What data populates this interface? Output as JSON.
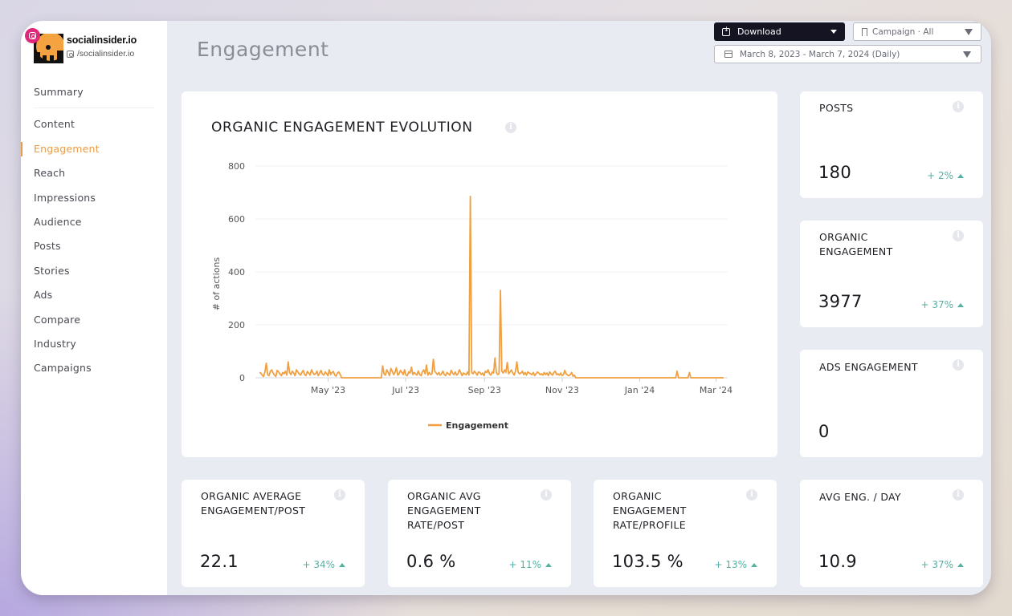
{
  "profile": {
    "name": "socialinsider.io",
    "handle": "/socialinsider.io",
    "network": "instagram"
  },
  "sidebar": {
    "items": [
      {
        "label": "Summary",
        "active": false
      },
      {
        "label": "Content",
        "active": false
      },
      {
        "label": "Engagement",
        "active": true
      },
      {
        "label": "Reach",
        "active": false
      },
      {
        "label": "Impressions",
        "active": false
      },
      {
        "label": "Audience",
        "active": false
      },
      {
        "label": "Posts",
        "active": false
      },
      {
        "label": "Stories",
        "active": false
      },
      {
        "label": "Ads",
        "active": false
      },
      {
        "label": "Compare",
        "active": false
      },
      {
        "label": "Industry",
        "active": false
      },
      {
        "label": "Campaigns",
        "active": false
      }
    ]
  },
  "header": {
    "title": "Engagement",
    "download_label": "Download",
    "campaign_label": "Campaign · All",
    "date_range_label": "March 8, 2023 - March 7, 2024 (Daily)"
  },
  "colors": {
    "accent": "#eb9b45",
    "series": "#f0a040",
    "positive": "#53b2a4",
    "dark_button": "#141423"
  },
  "chart_card": {
    "title": "ORGANIC ENGAGEMENT EVOLUTION",
    "info_icon": "info-icon"
  },
  "chart_data": {
    "type": "line",
    "title": "ORGANIC ENGAGEMENT EVOLUTION",
    "xlabel": "",
    "ylabel": "# of actions",
    "x_start": "2023-03-08",
    "x_end": "2024-03-07",
    "x_interval": "daily",
    "ylim": [
      0,
      800
    ],
    "y_ticks": [
      0,
      200,
      400,
      600,
      800
    ],
    "x_ticks": [
      {
        "label": "May '23",
        "date": "2023-05-01"
      },
      {
        "label": "Jul '23",
        "date": "2023-07-01"
      },
      {
        "label": "Sep '23",
        "date": "2023-09-01"
      },
      {
        "label": "Nov '23",
        "date": "2023-11-01"
      },
      {
        "label": "Jan '24",
        "date": "2024-01-01"
      },
      {
        "label": "Mar '24",
        "date": "2024-03-01"
      }
    ],
    "grid": true,
    "legend": {
      "position": "bottom",
      "entries": [
        "Engagement"
      ]
    },
    "series": [
      {
        "name": "Engagement",
        "values": [
          20,
          18,
          10,
          5,
          22,
          55,
          12,
          8,
          25,
          30,
          18,
          10,
          5,
          28,
          22,
          14,
          8,
          20,
          15,
          25,
          10,
          60,
          20,
          12,
          25,
          18,
          8,
          30,
          22,
          15,
          10,
          20,
          28,
          12,
          8,
          24,
          18,
          10,
          30,
          20,
          12,
          15,
          25,
          8,
          18,
          28,
          14,
          10,
          22,
          16,
          8,
          30,
          12,
          20,
          24,
          10,
          6,
          18,
          22,
          12,
          0,
          0,
          0,
          0,
          0,
          0,
          0,
          0,
          0,
          0,
          0,
          0,
          0,
          0,
          0,
          0,
          0,
          0,
          0,
          0,
          0,
          0,
          0,
          0,
          0,
          0,
          0,
          0,
          0,
          0,
          45,
          15,
          10,
          30,
          20,
          8,
          35,
          25,
          12,
          20,
          38,
          10,
          15,
          28,
          20,
          12,
          30,
          10,
          8,
          22,
          18,
          40,
          12,
          20,
          15,
          10,
          26,
          12,
          8,
          22,
          30,
          15,
          48,
          10,
          20,
          12,
          15,
          70,
          25,
          18,
          12,
          20,
          10,
          15,
          25,
          12,
          8,
          20,
          15,
          10,
          28,
          18,
          12,
          22,
          10,
          15,
          30,
          20,
          8,
          18,
          14,
          12,
          22,
          10,
          685,
          20,
          15,
          25,
          18,
          10,
          22,
          20,
          12,
          18,
          8,
          25,
          20,
          30,
          15,
          10,
          22,
          18,
          75,
          20,
          12,
          15,
          330,
          25,
          18,
          30,
          20,
          58,
          15,
          22,
          30,
          18,
          10,
          25,
          60,
          20,
          15,
          18,
          25,
          12,
          20,
          10,
          22,
          18,
          15,
          12,
          20,
          8,
          15,
          22,
          18,
          12,
          15,
          10,
          20,
          12,
          18,
          8,
          22,
          15,
          10,
          20,
          25,
          12,
          15,
          10,
          18,
          8,
          12,
          28,
          15,
          10,
          8,
          12,
          20,
          6,
          10,
          0,
          0,
          0,
          0,
          0,
          0,
          0,
          0,
          0,
          0,
          0,
          0,
          0,
          0,
          0,
          0,
          0,
          0,
          0,
          0,
          0,
          0,
          0,
          0,
          0,
          0,
          0,
          0,
          0,
          0,
          0,
          0,
          0,
          0,
          0,
          0,
          0,
          0,
          0,
          0,
          0,
          0,
          0,
          0,
          0,
          0,
          0,
          0,
          0,
          0,
          0,
          0,
          0,
          0,
          0,
          0,
          0,
          0,
          0,
          0,
          0,
          0,
          0,
          0,
          0,
          0,
          0,
          0,
          0,
          0,
          0,
          0,
          0,
          0,
          25,
          0,
          0,
          0,
          0,
          0,
          0,
          0,
          0,
          20,
          0,
          0,
          0,
          0,
          0,
          0,
          0,
          0,
          0,
          0,
          0,
          0,
          0,
          0,
          0,
          0,
          0,
          0,
          0,
          0,
          0,
          0,
          0,
          0,
          0
        ]
      }
    ]
  },
  "stats": {
    "posts": {
      "title": "POSTS",
      "value": "180",
      "change": "+ 2%",
      "direction": "up"
    },
    "organic_engagement": {
      "title": "ORGANIC ENGAGEMENT",
      "value": "3977",
      "change": "+ 37%",
      "direction": "up"
    },
    "ads_engagement": {
      "title": "ADS ENGAGEMENT",
      "value": "0"
    },
    "avg_eng_day": {
      "title": "AVG ENG. / DAY",
      "value": "10.9",
      "change": "+ 37%",
      "direction": "up"
    },
    "avg_eng_post": {
      "title": "ORGANIC AVERAGE ENGAGEMENT/POST",
      "value": "22.1",
      "change": "+ 34%",
      "direction": "up"
    },
    "avg_rate_post": {
      "title": "ORGANIC AVG ENGAGEMENT RATE/POST",
      "value": "0.6 %",
      "change": "+ 11%",
      "direction": "up"
    },
    "rate_profile": {
      "title": "ORGANIC ENGAGEMENT RATE/PROFILE",
      "value": "103.5 %",
      "change": "+ 13%",
      "direction": "up"
    }
  }
}
